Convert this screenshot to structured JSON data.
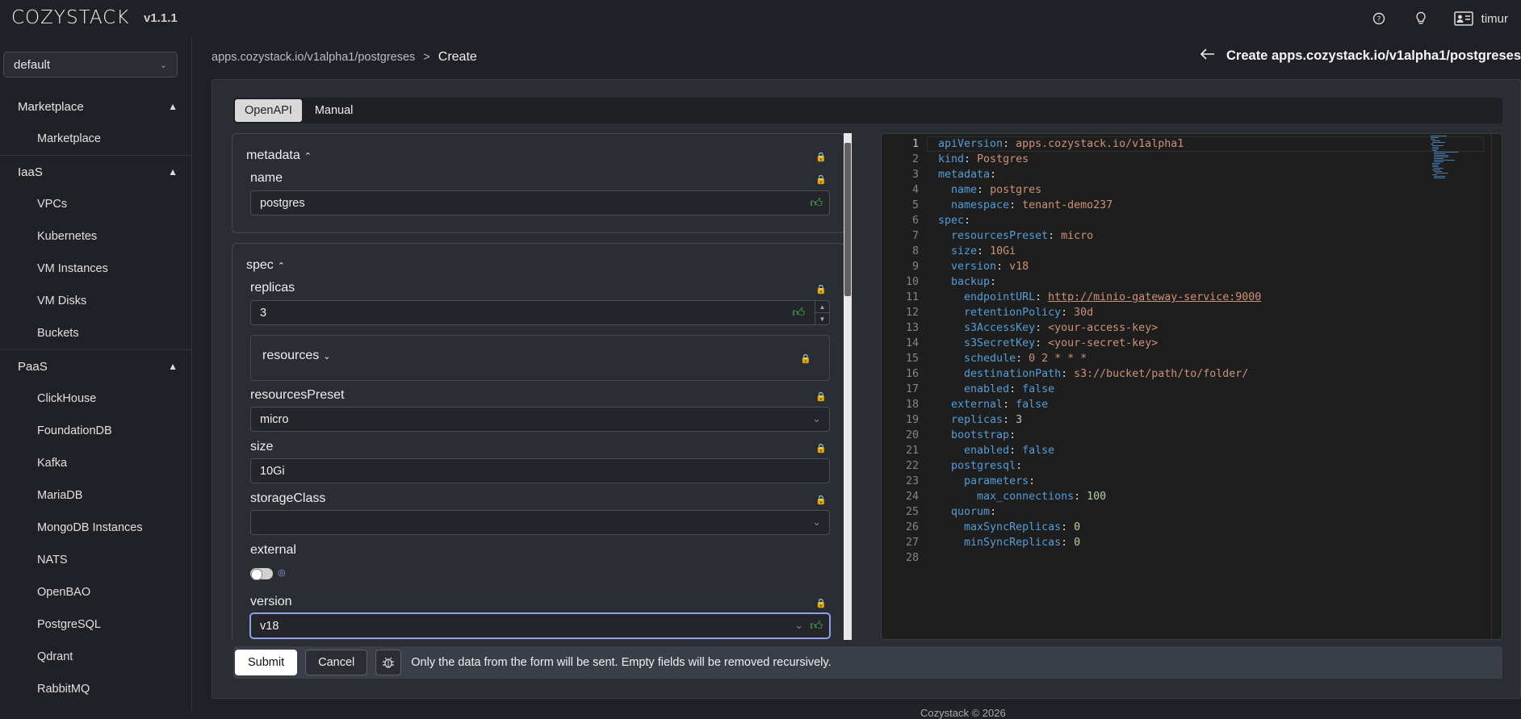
{
  "app": {
    "logo": "COZYSTACK",
    "version": "v1.1.1",
    "user": "timur"
  },
  "icons": {
    "help": "help-circle-icon",
    "tips": "lightbulb-icon",
    "user": "id-card-icon"
  },
  "namespace": {
    "selected": "default"
  },
  "sidebar": {
    "groups": [
      {
        "label": "Marketplace",
        "items": [
          "Marketplace"
        ]
      },
      {
        "label": "IaaS",
        "items": [
          "VPCs",
          "Kubernetes",
          "VM Instances",
          "VM Disks",
          "Buckets"
        ]
      },
      {
        "label": "PaaS",
        "items": [
          "ClickHouse",
          "FoundationDB",
          "Kafka",
          "MariaDB",
          "MongoDB Instances",
          "NATS",
          "OpenBAO",
          "PostgreSQL",
          "Qdrant",
          "RabbitMQ"
        ]
      }
    ]
  },
  "breadcrumb": {
    "path": "apps.cozystack.io/v1alpha1/postgreses",
    "separator": ">",
    "current": "Create"
  },
  "page_title": "Create apps.cozystack.io/v1alpha1/postgreses",
  "tabs": {
    "openapi": "OpenAPI",
    "manual": "Manual"
  },
  "form": {
    "metadata": {
      "title": "metadata",
      "name_label": "name",
      "name_value": "postgres"
    },
    "spec": {
      "title": "spec",
      "replicas_label": "replicas",
      "replicas_value": "3",
      "resources_label": "resources",
      "preset_label": "resourcesPreset",
      "preset_value": "micro",
      "size_label": "size",
      "size_value": "10Gi",
      "storage_label": "storageClass",
      "storage_value": "",
      "external_label": "external",
      "version_label": "version",
      "version_value": "v18"
    }
  },
  "yaml": [
    "apiVersion: apps.cozystack.io/v1alpha1",
    "kind: Postgres",
    "metadata:",
    "  name: postgres",
    "  namespace: tenant-demo237",
    "spec:",
    "  resourcesPreset: micro",
    "  size: 10Gi",
    "  version: v18",
    "  backup:",
    "    endpointURL: http://minio-gateway-service:9000",
    "    retentionPolicy: 30d",
    "    s3AccessKey: <your-access-key>",
    "    s3SecretKey: <your-secret-key>",
    "    schedule: 0 2 * * *",
    "    destinationPath: s3://bucket/path/to/folder/",
    "    enabled: false",
    "  external: false",
    "  replicas: 3",
    "  bootstrap:",
    "    enabled: false",
    "  postgresql:",
    "    parameters:",
    "      max_connections: 100",
    "  quorum:",
    "    maxSyncReplicas: 0",
    "    minSyncReplicas: 0",
    ""
  ],
  "footer": {
    "submit": "Submit",
    "cancel": "Cancel",
    "note": "Only the data from the form will be sent. Empty fields will be removed recursively.",
    "copyright": "Cozystack © 2026"
  },
  "colors": {
    "accent_green": "#58c25a",
    "focus_border": "#8ea0e8",
    "yaml_key": "#569cd6",
    "yaml_string": "#ce9178",
    "yaml_number": "#b5cea8"
  }
}
